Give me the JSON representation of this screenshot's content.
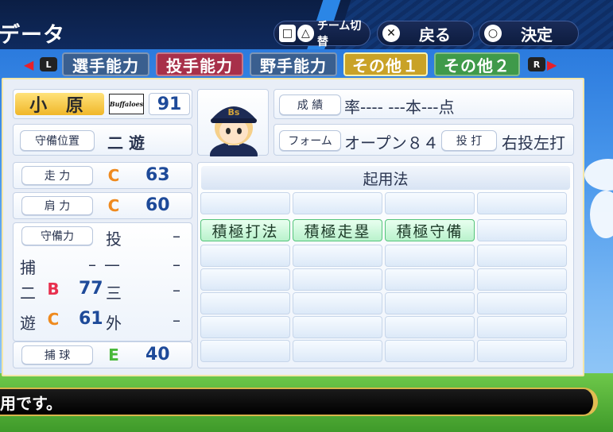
{
  "screen": {
    "title": "データ",
    "message": "用です。"
  },
  "controls": {
    "team_switch": "チーム切替",
    "back": "戻る",
    "confirm": "決定",
    "icons": [
      "square-button",
      "triangle-button",
      "cross-button",
      "circle-button"
    ]
  },
  "tabs": {
    "left_key": "L",
    "right_key": "R",
    "items": [
      {
        "label": "選手能力",
        "color": "#3a5f8f"
      },
      {
        "label": "投手能力",
        "color": "#a8304a"
      },
      {
        "label": "野手能力",
        "color": "#3a5f8f"
      },
      {
        "label": "その他１",
        "color": "#c9a227"
      },
      {
        "label": "その他２",
        "color": "#3f9a4a"
      }
    ]
  },
  "player": {
    "name": "小 原",
    "team_logo": "Buffaloes",
    "number": "91",
    "position_label": "守備位置",
    "position_value": "二 遊",
    "cap_letters": "Bs"
  },
  "record": {
    "label": "成 績",
    "value": "率---- ---本---点"
  },
  "form": {
    "label": "フォーム",
    "value": "オープン８４",
    "bats_label": "投 打",
    "bats_value": "右投左打"
  },
  "abilities": {
    "run_label": "走 力",
    "run_grade": "C",
    "run_value": "63",
    "arm_label": "肩 力",
    "arm_grade": "C",
    "arm_value": "60",
    "fielding_label": "守備力",
    "catch_label": "捕 球",
    "catch_grade": "E",
    "catch_value": "40"
  },
  "fielding": [
    {
      "pos": "投",
      "grade": "",
      "value": "",
      "dash": "–"
    },
    {
      "pos": "捕",
      "grade": "",
      "value": "–",
      "dash": "–"
    },
    {
      "pos": "三",
      "grade": "",
      "value": "",
      "dash": "–"
    },
    {
      "pos": "二",
      "grade": "B",
      "value": "77",
      "dash": ""
    },
    {
      "pos": "外",
      "grade": "",
      "value": "",
      "dash": "–"
    },
    {
      "pos": "遊",
      "grade": "C",
      "value": "61",
      "dash": ""
    }
  ],
  "usage": {
    "title": "起用法",
    "tags": [
      "積極打法",
      "積極走塁",
      "積極守備"
    ]
  },
  "grade_colors": {
    "B": "#e8304e",
    "C": "#ef8a1e",
    "E": "#49b83a"
  }
}
